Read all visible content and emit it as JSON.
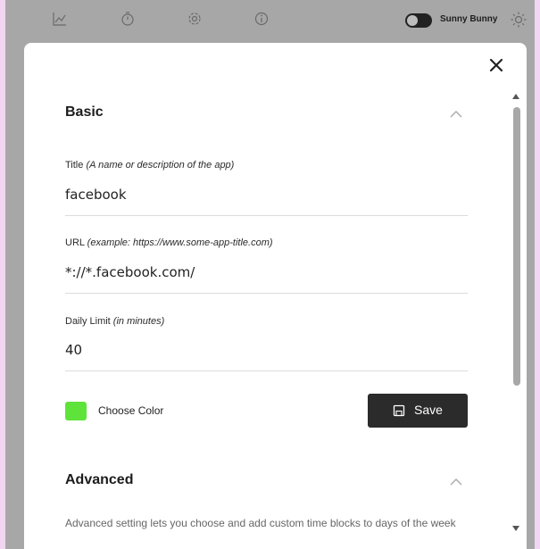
{
  "topbar": {
    "icons": [
      "chart-icon",
      "timer-icon",
      "settings-icon",
      "info-icon"
    ],
    "theme_label": "Sunny Bunny",
    "theme_toggle_on": false,
    "theme_icon": "sun-icon"
  },
  "modal": {
    "close_icon": "close-icon",
    "basic": {
      "title": "Basic",
      "expanded": true,
      "title_field": {
        "label": "Title",
        "hint": "(A name or description of the app)",
        "value": "facebook"
      },
      "url_field": {
        "label": "URL",
        "hint": "(example: https://www.some-app-title.com)",
        "value": "*://*.facebook.com/"
      },
      "limit_field": {
        "label": "Daily Limit",
        "hint": "(in minutes)",
        "value": "40"
      },
      "color": {
        "label": "Choose Color",
        "value": "#5ee33a"
      },
      "save_label": "Save"
    },
    "advanced": {
      "title": "Advanced",
      "expanded": true,
      "description": "Advanced setting lets you choose and add custom time blocks to days of the week"
    }
  },
  "colors": {
    "backdrop": "#a7a7a7",
    "page_border": "#f0d6f0",
    "save_button": "#2b2b2b"
  }
}
